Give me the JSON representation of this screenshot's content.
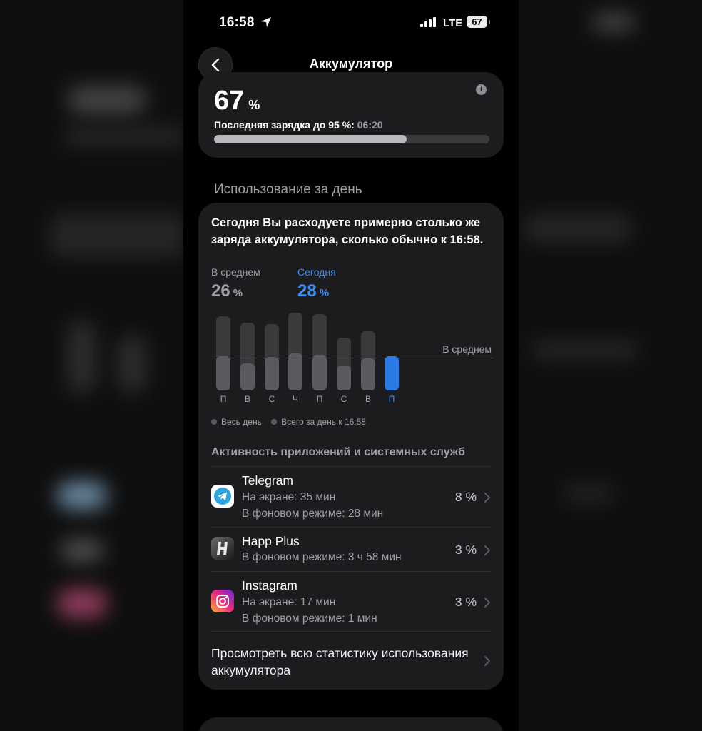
{
  "status_bar": {
    "time": "16:58",
    "network": "LTE",
    "battery_level": "67",
    "icons": [
      "location-arrow-icon",
      "cellular-signal-icon",
      "battery-icon"
    ]
  },
  "nav": {
    "back_icon": "chevron-left-icon",
    "title": "Аккумулятор"
  },
  "battery_card": {
    "percent": "67",
    "percent_sign": "%",
    "last_charge_label": "Последняя зарядка до 95 %:",
    "last_charge_time": "06:20",
    "charge_fill_fraction": 0.7
  },
  "usage": {
    "section_title": "Использование за день",
    "summary": "Сегодня Вы расходуете примерно столько же заряда аккумулятора, сколько обычно к 16:58.",
    "average_label": "В среднем",
    "average_value": "26",
    "today_label": "Сегодня",
    "today_value": "28",
    "unit": "%",
    "chart_avg_label": "В среднем",
    "days": [
      "П",
      "В",
      "С",
      "Ч",
      "П",
      "С",
      "В",
      "П"
    ],
    "legend_all_day": "Весь день",
    "legend_until": "Всего за день к 16:58",
    "accent_color": "#2c7be5"
  },
  "apps": {
    "title": "Активность приложений и системных служб",
    "items": [
      {
        "name": "Telegram",
        "line1": "На экране: 35 мин",
        "line2": "В фоновом режиме: 28 мин",
        "percent": "8 %",
        "icon": "telegram-icon"
      },
      {
        "name": "Happ Plus",
        "line1": "В фоновом режиме: 3 ч 58 мин",
        "percent": "3 %",
        "icon": "happ-plus-icon"
      },
      {
        "name": "Instagram",
        "line1": "На экране: 17 мин",
        "line2": "В фоновом режиме: 1 мин",
        "percent": "3 %",
        "icon": "instagram-icon"
      }
    ],
    "view_all": "Просмотреть всю статистику использования аккумулятора"
  }
}
